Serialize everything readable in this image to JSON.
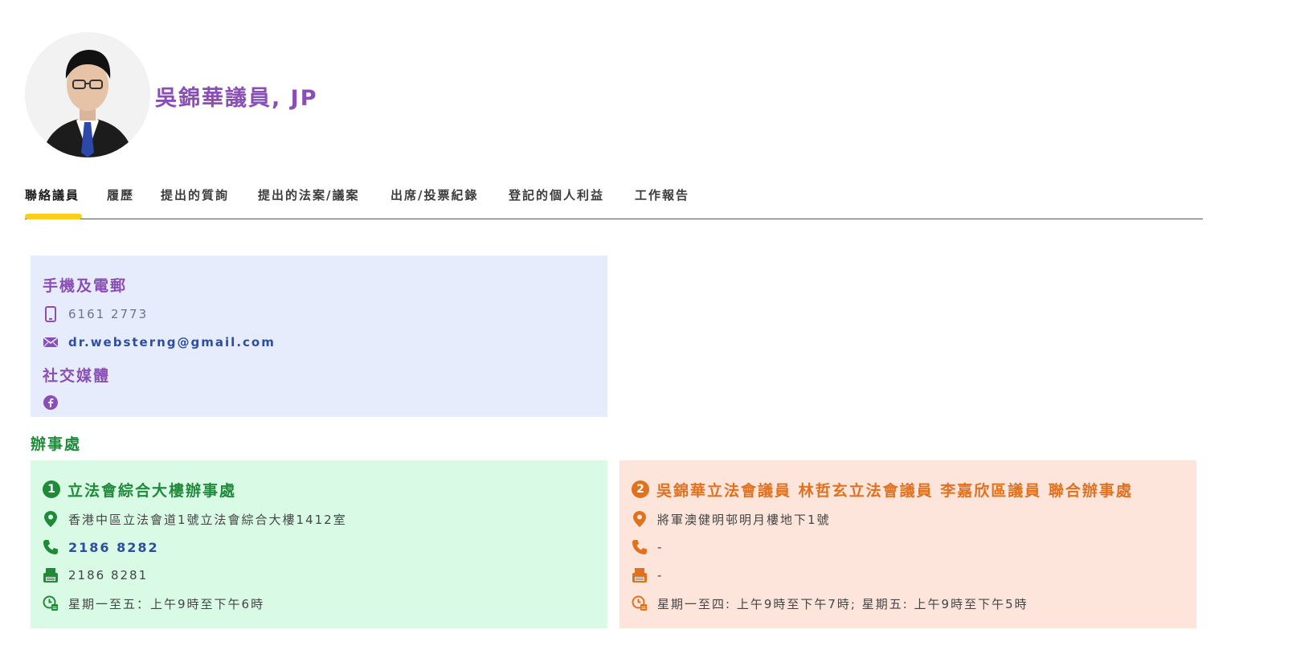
{
  "member": {
    "name": "吳錦華議員, JP",
    "photo_alt": "avatar"
  },
  "tabs": [
    {
      "label": "聯絡議員",
      "active": true
    },
    {
      "label": "履歷",
      "active": false
    },
    {
      "label": "提出的質詢",
      "active": false
    },
    {
      "label": "提出的法案/議案",
      "active": false
    },
    {
      "label": "出席/投票紀錄",
      "active": false
    },
    {
      "label": "登記的個人利益",
      "active": false
    },
    {
      "label": "工作報告",
      "active": false
    }
  ],
  "contact": {
    "mobile_heading": "手機及電郵",
    "phone": "6161 2773",
    "email": "dr.websterng@gmail.com",
    "social_heading": "社交媒體",
    "social_icon": "facebook-icon"
  },
  "offices": {
    "heading": "辦事處",
    "items": [
      {
        "number": "1",
        "name": "立法會綜合大樓辦事處",
        "address": "香港中區立法會道1號立法會綜合大樓1412室",
        "tel": "2186 8282",
        "fax": "2186 8281",
        "hours": "星期一至五：上午9時至下午6時"
      },
      {
        "number": "2",
        "name": "吳錦華立法會議員 林哲玄立法會議員 李嘉欣區議員 聯合辦事處",
        "address": "將軍澳健明邨明月樓地下1號",
        "tel": "-",
        "fax": "-",
        "hours": "星期一至四: 上午9時至下午7時; 星期五: 上午9時至下午5時"
      }
    ]
  },
  "colors": {
    "purple": "#8a4fb5",
    "green": "#1f8a3a",
    "orange": "#e0721f",
    "tab_underline": "#f7cf1f",
    "contact_bg": "#e6ecfb",
    "office1_bg": "#d9fbe6",
    "office2_bg": "#fde5dc"
  }
}
